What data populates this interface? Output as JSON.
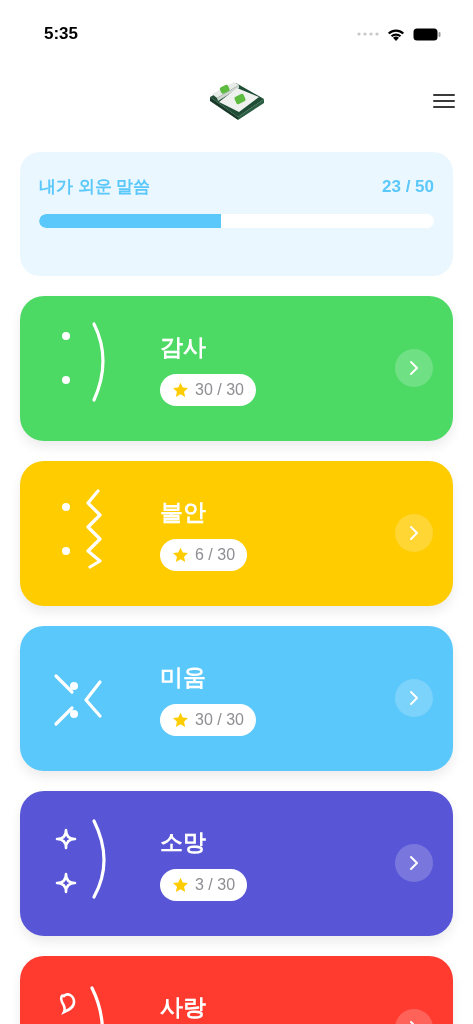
{
  "status_bar": {
    "time": "5:35"
  },
  "progress": {
    "title": "내가 외운 말씀",
    "count": "23 / 50",
    "level": 0.46
  },
  "categories": [
    {
      "title": "감사",
      "score": "30 / 30",
      "color": "#4cd964",
      "kind": "smile"
    },
    {
      "title": "불안",
      "score": "6 / 30",
      "color": "#ffcc00",
      "kind": "anxious"
    },
    {
      "title": "미움",
      "score": "30 / 30",
      "color": "#5ac8fa",
      "kind": "angry"
    },
    {
      "title": "소망",
      "score": "3 / 30",
      "color": "#5856d6",
      "kind": "hopeful"
    },
    {
      "title": "사랑",
      "color": "#ff3b30",
      "kind": "love"
    }
  ]
}
